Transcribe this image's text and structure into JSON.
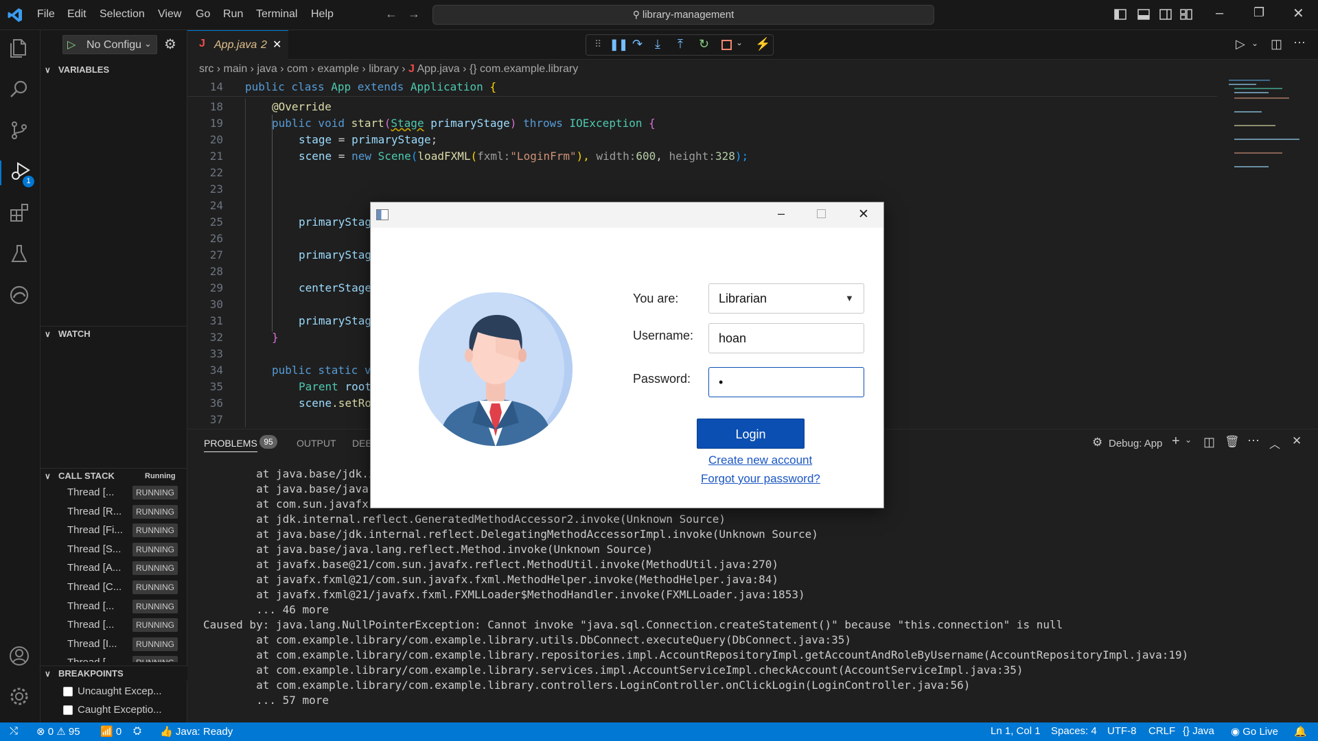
{
  "titlebar": {
    "menu": [
      "File",
      "Edit",
      "Selection",
      "View",
      "Go",
      "Run",
      "Terminal",
      "Help"
    ],
    "search": "library-management"
  },
  "activity_bar": {
    "icons": [
      "explorer-icon",
      "search-icon",
      "source-control-icon",
      "run-debug-icon",
      "extensions-icon",
      "testing-icon",
      "edge-icon",
      "account-icon",
      "settings-icon"
    ],
    "debug_badge": "1"
  },
  "debug_toolbar": {
    "config": "No Configu"
  },
  "sidebar": {
    "variables": "VARIABLES",
    "watch": "WATCH",
    "call_stack": "CALL STACK",
    "call_stack_status": "Running",
    "threads": [
      {
        "name": "Thread [...",
        "state": "RUNNING"
      },
      {
        "name": "Thread [R...",
        "state": "RUNNING"
      },
      {
        "name": "Thread [Fi...",
        "state": "RUNNING"
      },
      {
        "name": "Thread [S...",
        "state": "RUNNING"
      },
      {
        "name": "Thread [A...",
        "state": "RUNNING"
      },
      {
        "name": "Thread [C...",
        "state": "RUNNING"
      },
      {
        "name": "Thread [...",
        "state": "RUNNING"
      },
      {
        "name": "Thread [...",
        "state": "RUNNING"
      },
      {
        "name": "Thread [I...",
        "state": "RUNNING"
      },
      {
        "name": "Thread [...",
        "state": "RUNNING"
      }
    ],
    "breakpoints": "BREAKPOINTS",
    "breakpoint_items": [
      "Uncaught Excep...",
      "Caught Exceptio..."
    ]
  },
  "editor": {
    "tab": "App.java",
    "tab_number": "2",
    "breadcrumb": [
      "src",
      "main",
      "java",
      "com",
      "example",
      "library",
      "App.java",
      "{} com.example.library"
    ],
    "sticky_line": "14",
    "line_numbers": [
      "18",
      "19",
      "20",
      "21",
      "22",
      "23",
      "24",
      "25",
      "26",
      "27",
      "28",
      "29",
      "30",
      "31",
      "32",
      "33",
      "34",
      "35",
      "36",
      "37"
    ],
    "lines": {
      "l14a": "public class ",
      "l14b": "App",
      "l14c": " extends ",
      "l14d": "Application",
      "l14e": " {",
      "l18": "@Override",
      "l19a": "public void ",
      "l19b": "start",
      "l19c": "(",
      "l19d": "Stage",
      "l19e": " primaryStage",
      "l19f": ") ",
      "l19g": "throws ",
      "l19h": "IOException",
      "l19i": " {",
      "l20a": "stage",
      "l20b": " = ",
      "l20c": "primaryStage",
      "l20d": ";",
      "l21a": "scene",
      "l21b": " = ",
      "l21c": "new ",
      "l21d": "Scene",
      "l21e": "(",
      "l21f": "loadFXML",
      "l21g": "(",
      "l21h": "fxml:",
      "l21i": "\"LoginFrm\"",
      "l21j": "), ",
      "l21k": "width:",
      "l21l": "600",
      "l21m": ", ",
      "l21n": "height:",
      "l21o": "328",
      "l21p": ");",
      "l25": "primaryStag",
      "l27": "primaryStag",
      "l29": "centerStage",
      "l31": "primaryStag",
      "l32": "}",
      "l34a": "public static ",
      "l34b": "v",
      "l35a": "Parent ",
      "l35b": "root",
      "l36a": "scene",
      "l36b": ".setRo"
    }
  },
  "panel": {
    "tabs": [
      "PROBLEMS",
      "OUTPUT",
      "DEB"
    ],
    "problems_count": "95",
    "debug_target": "Debug: App",
    "terminal_lines": [
      "        at java.base/jdk.ir",
      "        at java.base/java.l",
      "        at com.sun.javafx.r",
      "        at jdk.internal.reflect.GeneratedMethodAccessor2.invoke(Unknown Source)",
      "        at java.base/jdk.internal.reflect.DelegatingMethodAccessorImpl.invoke(Unknown Source)",
      "        at java.base/java.lang.reflect.Method.invoke(Unknown Source)",
      "        at javafx.base@21/com.sun.javafx.reflect.MethodUtil.invoke(MethodUtil.java:270)",
      "        at javafx.fxml@21/com.sun.javafx.fxml.MethodHelper.invoke(MethodHelper.java:84)",
      "        at javafx.fxml@21/javafx.fxml.FXMLLoader$MethodHandler.invoke(FXMLLoader.java:1853)",
      "        ... 46 more",
      "Caused by: java.lang.NullPointerException: Cannot invoke \"java.sql.Connection.createStatement()\" because \"this.connection\" is null",
      "        at com.example.library/com.example.library.utils.DbConnect.executeQuery(DbConnect.java:35)",
      "        at com.example.library/com.example.library.repositories.impl.AccountRepositoryImpl.getAccountAndRoleByUsername(AccountRepositoryImpl.java:19)",
      "        at com.example.library/com.example.library.services.impl.AccountServiceImpl.checkAccount(AccountServiceImpl.java:35)",
      "        at com.example.library/com.example.library.controllers.LoginController.onClickLogin(LoginController.java:56)",
      "        ... 57 more"
    ]
  },
  "statusbar": {
    "errors": "0",
    "warnings": "95",
    "ports": "0",
    "java_status": "Java: Ready",
    "position": "Ln 1, Col 1",
    "spaces": "Spaces: 4",
    "encoding": "UTF-8",
    "eol": "CRLF",
    "language": "Java",
    "golive": "Go Live"
  },
  "login_dialog": {
    "role_label": "You are:",
    "role_value": "Librarian",
    "username_label": "Username:",
    "username_value": "hoan",
    "password_label": "Password:",
    "password_value": "•",
    "login_button": "Login",
    "create_account": "Create new account",
    "forgot_password": "Forgot your password?"
  },
  "colors": {
    "accent": "#0078d4",
    "login_button": "#0b4fb3",
    "link": "#1a56c4"
  }
}
